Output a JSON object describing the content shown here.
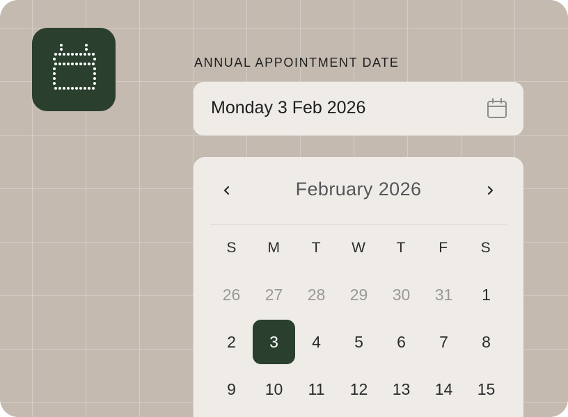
{
  "colors": {
    "background": "#c4bab0",
    "accent": "#2a3f2e",
    "panel": "#efece8",
    "text": "#1e1e1e",
    "muted_text": "#9a9894"
  },
  "app_icon": {
    "icon": "calendar-icon"
  },
  "field": {
    "label": "Annual appointment date",
    "value": "Monday 3 Feb 2026",
    "icon": "calendar-icon"
  },
  "calendar": {
    "prev_label": "‹",
    "next_label": "›",
    "month_title": "February 2026",
    "weekdays": [
      "S",
      "M",
      "T",
      "W",
      "T",
      "F",
      "S"
    ],
    "weeks": [
      [
        {
          "label": "26",
          "outside": true
        },
        {
          "label": "27",
          "outside": true
        },
        {
          "label": "28",
          "outside": true
        },
        {
          "label": "29",
          "outside": true
        },
        {
          "label": "30",
          "outside": true
        },
        {
          "label": "31",
          "outside": true
        },
        {
          "label": "1",
          "outside": false
        }
      ],
      [
        {
          "label": "2",
          "outside": false
        },
        {
          "label": "3",
          "outside": false,
          "selected": true
        },
        {
          "label": "4",
          "outside": false
        },
        {
          "label": "5",
          "outside": false
        },
        {
          "label": "6",
          "outside": false
        },
        {
          "label": "7",
          "outside": false
        },
        {
          "label": "8",
          "outside": false
        }
      ],
      [
        {
          "label": "9",
          "outside": false
        },
        {
          "label": "10",
          "outside": false
        },
        {
          "label": "11",
          "outside": false
        },
        {
          "label": "12",
          "outside": false
        },
        {
          "label": "13",
          "outside": false
        },
        {
          "label": "14",
          "outside": false
        },
        {
          "label": "15",
          "outside": false
        }
      ]
    ]
  }
}
